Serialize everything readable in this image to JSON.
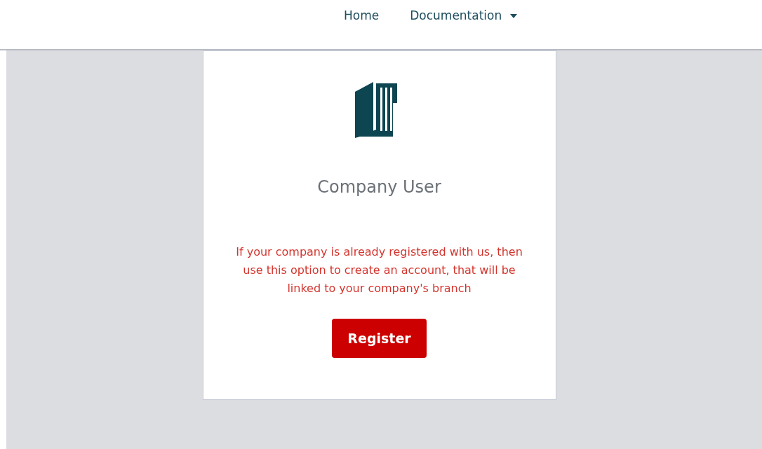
{
  "nav": [
    {
      "label": "Home",
      "kind": "link"
    },
    {
      "label": "Documentation",
      "kind": "dropdown"
    }
  ],
  "card": {
    "title": "Company User",
    "description": "If your company is already registered with us, then use this option to create an account, that will be linked to your company's branch",
    "button": "Register"
  }
}
